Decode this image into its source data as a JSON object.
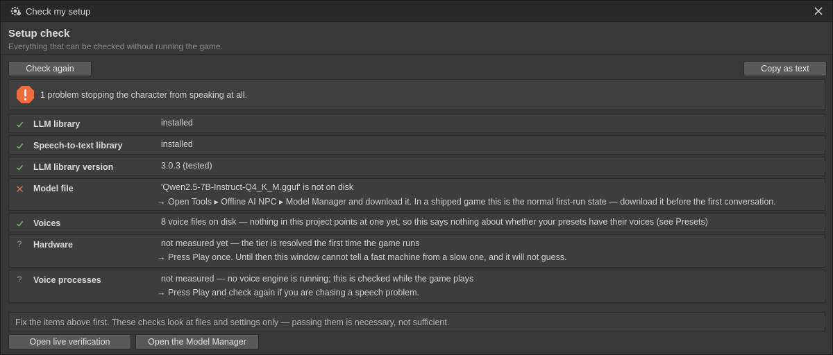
{
  "window": {
    "title": "Check my setup"
  },
  "header": {
    "title": "Setup check",
    "subtitle": "Everything that can be checked without running the game."
  },
  "toolbar": {
    "check_again_label": "Check again",
    "copy_label": "Copy as text"
  },
  "alert": {
    "icon": "exclamation-icon",
    "color": "#f26b3a",
    "text": "1 problem stopping the character from speaking at all."
  },
  "colors": {
    "ok": "#6fb87a",
    "fail": "#e06c5c",
    "unknown": "#9a9a9a"
  },
  "checks": [
    {
      "status": "ok",
      "name": "LLM library",
      "value": "installed",
      "hint": ""
    },
    {
      "status": "ok",
      "name": "Speech-to-text library",
      "value": "installed",
      "hint": ""
    },
    {
      "status": "ok",
      "name": "LLM library version",
      "value": "3.0.3 (tested)",
      "hint": ""
    },
    {
      "status": "fail",
      "name": "Model file",
      "value": "'Qwen2.5-7B-Instruct-Q4_K_M.gguf' is not on disk",
      "hint": "→ Open Tools ▸ Offline AI NPC ▸ Model Manager and download it. In a shipped game this is the normal first-run state — download it before the first conversation."
    },
    {
      "status": "ok",
      "name": "Voices",
      "value": "8 voice files on disk — nothing in this project points at one yet, so this says nothing about whether your presets have their voices (see Presets)",
      "hint": ""
    },
    {
      "status": "unknown",
      "name": "Hardware",
      "value": "not measured yet — the tier is resolved the first time the game runs",
      "hint": "→ Press Play once. Until then this window cannot tell a fast machine from a slow one, and it will not guess."
    },
    {
      "status": "unknown",
      "name": "Voice processes",
      "value": "not measured — no voice engine is running; this is checked while the game plays",
      "hint": "→ Press Play and check again if you are chasing a speech problem."
    }
  ],
  "footer": {
    "note": "Fix the items above first. These checks look at files and settings only — passing them is necessary, not sufficient.",
    "live_verification_label": "Open live verification",
    "model_manager_label": "Open the Model Manager"
  }
}
